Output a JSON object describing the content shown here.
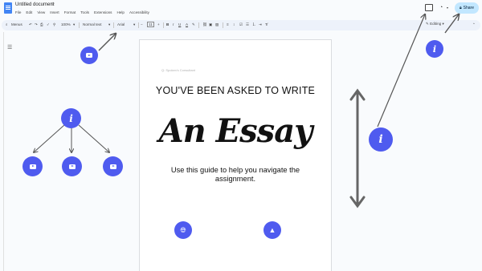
{
  "titlebar": {
    "doc_title": "Untitled document",
    "menu": [
      "File",
      "Edit",
      "View",
      "Insert",
      "Format",
      "Tools",
      "Extensions",
      "Help",
      "Accessibility"
    ],
    "share_label": "Share"
  },
  "toolbar": {
    "search_menus": "Menus",
    "zoom": "100%",
    "style": "Normal text",
    "font": "Arial",
    "font_size": "11",
    "editing": "Editing"
  },
  "page": {
    "header_hint": "Q: Spoken's Consultant",
    "headline": "YOU'VE BEEN ASKED TO WRITE",
    "script_title": "An Essay",
    "subtitle": "Use this guide to help you navigate the assignment."
  },
  "overlay": {
    "accent": "#4f5bef",
    "info_glyph": "i"
  }
}
